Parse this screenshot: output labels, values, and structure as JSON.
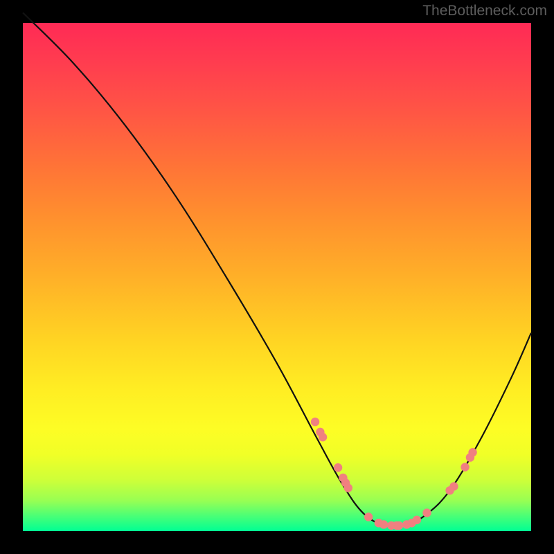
{
  "watermark": "TheBottleneck.com",
  "chart_data": {
    "type": "line",
    "title": "",
    "xlabel": "",
    "ylabel": "",
    "xlim": [
      0,
      100
    ],
    "ylim": [
      0,
      100
    ],
    "curve": [
      {
        "x": 0,
        "y": 102
      },
      {
        "x": 10,
        "y": 92
      },
      {
        "x": 20,
        "y": 80
      },
      {
        "x": 30,
        "y": 66
      },
      {
        "x": 40,
        "y": 50
      },
      {
        "x": 50,
        "y": 33
      },
      {
        "x": 58,
        "y": 18
      },
      {
        "x": 63,
        "y": 9
      },
      {
        "x": 67,
        "y": 3.5
      },
      {
        "x": 71,
        "y": 1.2
      },
      {
        "x": 75,
        "y": 1.2
      },
      {
        "x": 79,
        "y": 3.0
      },
      {
        "x": 84,
        "y": 8
      },
      {
        "x": 90,
        "y": 18
      },
      {
        "x": 96,
        "y": 30
      },
      {
        "x": 100,
        "y": 39
      }
    ],
    "markers": [
      {
        "x": 57.5,
        "y": 21.5
      },
      {
        "x": 58.5,
        "y": 19.5
      },
      {
        "x": 59.0,
        "y": 18.5
      },
      {
        "x": 62.0,
        "y": 12.5
      },
      {
        "x": 63.0,
        "y": 10.5
      },
      {
        "x": 63.5,
        "y": 9.5
      },
      {
        "x": 64.0,
        "y": 8.5
      },
      {
        "x": 68.0,
        "y": 2.8
      },
      {
        "x": 70.0,
        "y": 1.6
      },
      {
        "x": 71.0,
        "y": 1.3
      },
      {
        "x": 72.5,
        "y": 1.1
      },
      {
        "x": 73.5,
        "y": 1.1
      },
      {
        "x": 74.0,
        "y": 1.1
      },
      {
        "x": 75.5,
        "y": 1.3
      },
      {
        "x": 76.5,
        "y": 1.6
      },
      {
        "x": 77.5,
        "y": 2.2
      },
      {
        "x": 79.5,
        "y": 3.6
      },
      {
        "x": 84.0,
        "y": 8.0
      },
      {
        "x": 84.8,
        "y": 8.8
      },
      {
        "x": 87.0,
        "y": 12.6
      },
      {
        "x": 88.0,
        "y": 14.5
      },
      {
        "x": 88.5,
        "y": 15.5
      }
    ],
    "marker_color": "#f08080",
    "curve_color": "#111111"
  }
}
